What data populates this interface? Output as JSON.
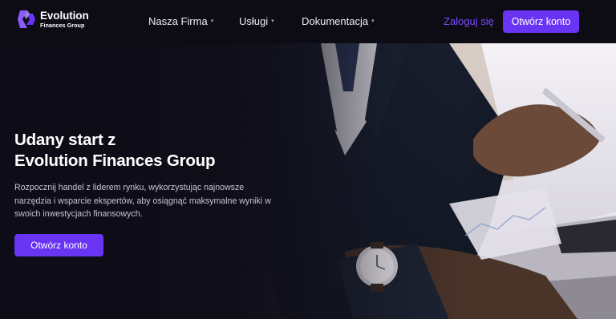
{
  "brand": {
    "name": "Evolution",
    "subtitle": "Finances Group",
    "logo_icon": "evolution-logo-icon",
    "accent_color": "#6a34f5",
    "login_color": "#7b4dff"
  },
  "nav": {
    "items": [
      {
        "label": "Nasza Firma",
        "has_dropdown": true
      },
      {
        "label": "Usługi",
        "has_dropdown": true
      },
      {
        "label": "Dokumentacja",
        "has_dropdown": true
      }
    ],
    "dropdown_icon": "chevron-down-icon",
    "login_label": "Zaloguj się",
    "cta_label": "Otwórz konto"
  },
  "hero": {
    "title_lines": [
      "Udany start z",
      "Evolution Finances Group"
    ],
    "description_lines": [
      "Rozpocznij handel z liderem rynku, wykorzystując najnowsze",
      "narzędzia i wsparcie ekspertów, aby osiągnąć maksymalne wyniki w",
      "swoich inwestycjach finansowych."
    ],
    "cta_label": "Otwórz konto",
    "background_image": "business-people-meeting-photo"
  }
}
